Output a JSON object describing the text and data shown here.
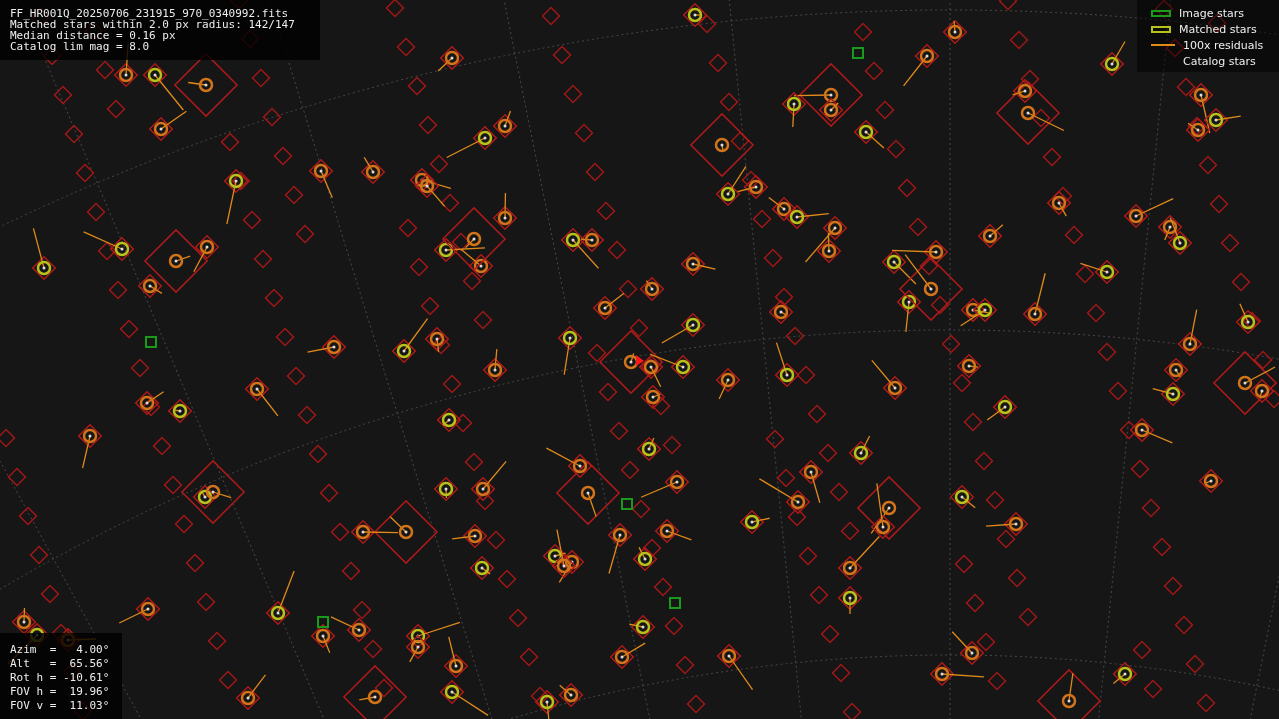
{
  "file_info": {
    "lines": [
      "FF_HR001Q_20250706_231915_970_0340992.fits",
      "Matched stars within 2.0 px radius: 142/147",
      "Median distance = 0.16 px",
      "Catalog lim mag = 8.0"
    ]
  },
  "legend": [
    {
      "label": "Image stars",
      "kind": "image"
    },
    {
      "label": "Matched stars",
      "kind": "matched"
    },
    {
      "label": "100x residuals",
      "kind": "residual"
    },
    {
      "label": "Catalog stars",
      "kind": "catalog"
    }
  ],
  "camera_info": {
    "lines": [
      "Azim  =   4.00°",
      "Alt   =  65.56°",
      "Rot h = -10.61°",
      "FOV h =  19.96°",
      "FOV v =  11.03°"
    ]
  }
}
